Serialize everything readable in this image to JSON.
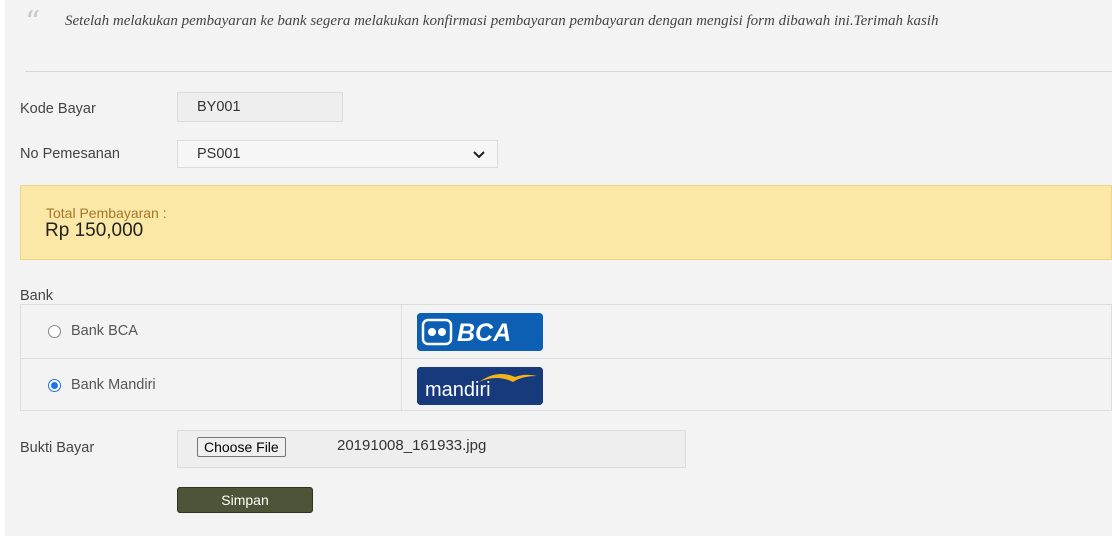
{
  "notice": {
    "text": "Setelah melakukan pembayaran ke bank segera melakukan konfirmasi pembayaran pembayaran dengan mengisi form dibawah ini.Terimah kasih"
  },
  "form": {
    "kode_bayar": {
      "label": "Kode Bayar",
      "value": "BY001"
    },
    "no_pemesanan": {
      "label": "No Pemesanan",
      "value": "PS001"
    },
    "total": {
      "label": "Total Pembayaran :",
      "value": "Rp 150,000"
    },
    "bank": {
      "label": "Bank",
      "options": [
        {
          "label": "Bank BCA",
          "selected": false,
          "logo_text": "BCA",
          "logo_icon": "bca-logo"
        },
        {
          "label": "Bank Mandiri",
          "selected": true,
          "logo_text": "mandiri",
          "logo_icon": "mandiri-logo"
        }
      ]
    },
    "bukti_bayar": {
      "label": "Bukti Bayar",
      "button_label": "Choose File",
      "file_name": "20191008_161933.jpg"
    },
    "submit_label": "Simpan"
  },
  "colors": {
    "panel_bg": "#f3f3f3",
    "alert_bg": "#fbe8a6",
    "alert_label": "#a3762f",
    "submit_bg": "#4d5438",
    "bca_blue": "#0c5fb3",
    "mandiri_blue": "#163a7b",
    "mandiri_gold": "#f5b21b",
    "radio_checked": "#1a73e8"
  }
}
